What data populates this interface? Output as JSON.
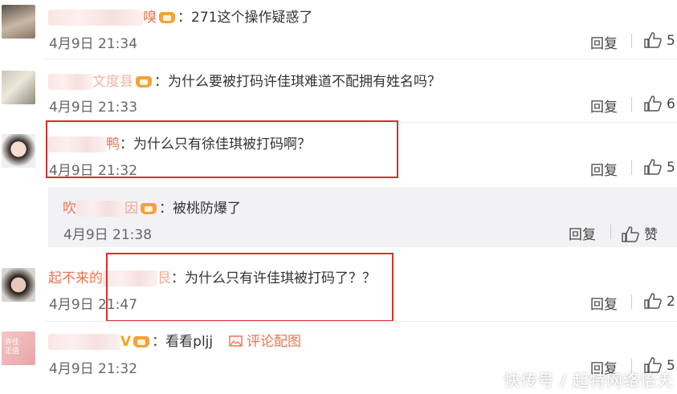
{
  "comments": [
    {
      "name_visible": "嗅",
      "text": "：271这个操作疑惑了",
      "time": "4月9日 21:34",
      "reply": "回复",
      "likes": "5"
    },
    {
      "name_visible": "文度县",
      "text": "：为什么要被打码许佳琪难道不配拥有姓名吗？",
      "time": "4月9日 21:33",
      "reply": "回复",
      "likes": "6"
    },
    {
      "name_visible": "鸭",
      "text": "：为什么只有徐佳琪被打码啊？",
      "time": "4月9日 21:32",
      "reply": "回复",
      "likes": "5"
    },
    {
      "name_visible": "起不来的",
      "name_tail": "艮",
      "text": "：为什么只有许佳琪被打码了？？",
      "time": "4月9日 21:47",
      "reply": "回复",
      "likes": "2"
    },
    {
      "name_visible": "V",
      "text": "：看看pljj",
      "image_link": "评论配图",
      "time": "4月9日 21:32",
      "reply": "回复",
      "likes": "5"
    }
  ],
  "subreply": {
    "name_visible": "吹",
    "name_tail": "因",
    "text": "：被桃防爆了",
    "time": "4月9日 21:38",
    "reply": "回复",
    "likes": "赞"
  },
  "avatar_labels": {
    "fifth": "许佳\n正值"
  },
  "watermark": "快传号 / 起特网络恰天",
  "colors": {
    "name": "#eb7350",
    "highlight": "#d2312f",
    "subreply_bg": "#f2f2f5"
  }
}
